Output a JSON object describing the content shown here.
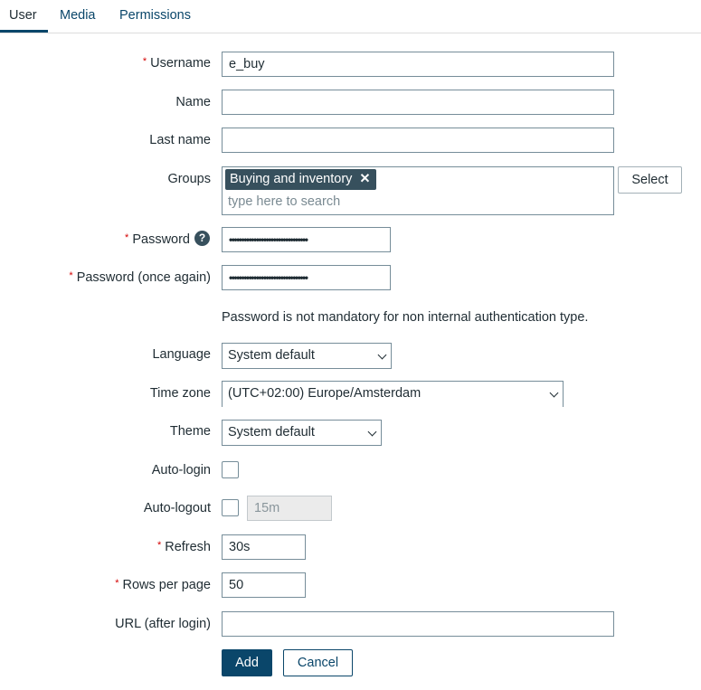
{
  "tabs": [
    {
      "label": "User",
      "active": true
    },
    {
      "label": "Media",
      "active": false
    },
    {
      "label": "Permissions",
      "active": false
    }
  ],
  "form": {
    "username": {
      "label": "Username",
      "required": true,
      "value": "e_buy"
    },
    "name": {
      "label": "Name",
      "value": ""
    },
    "last_name": {
      "label": "Last name",
      "value": ""
    },
    "groups": {
      "label": "Groups",
      "selected": [
        "Buying and inventory"
      ],
      "remove_glyph": "✕",
      "placeholder": "type here to search",
      "select_button": "Select"
    },
    "password": {
      "label": "Password",
      "required": true,
      "value": "••••••••••••••••••••••••••••••••",
      "help_glyph": "?"
    },
    "password_again": {
      "label": "Password (once again)",
      "required": true,
      "value": "••••••••••••••••••••••••••••••••"
    },
    "password_note": "Password is not mandatory for non internal authentication type.",
    "language": {
      "label": "Language",
      "value": "System default"
    },
    "time_zone": {
      "label": "Time zone",
      "value": "(UTC+02:00) Europe/Amsterdam"
    },
    "theme": {
      "label": "Theme",
      "value": "System default"
    },
    "auto_login": {
      "label": "Auto-login",
      "checked": false
    },
    "auto_logout": {
      "label": "Auto-logout",
      "checked": false,
      "value": "15m"
    },
    "refresh": {
      "label": "Refresh",
      "required": true,
      "value": "30s"
    },
    "rows_per_page": {
      "label": "Rows per page",
      "required": true,
      "value": "50"
    },
    "url_after_login": {
      "label": "URL (after login)",
      "value": ""
    },
    "required_marker": "*"
  },
  "actions": {
    "add": "Add",
    "cancel": "Cancel"
  },
  "colors": {
    "primary": "#0a466a",
    "required": "#d40000",
    "chip": "#37505d"
  }
}
